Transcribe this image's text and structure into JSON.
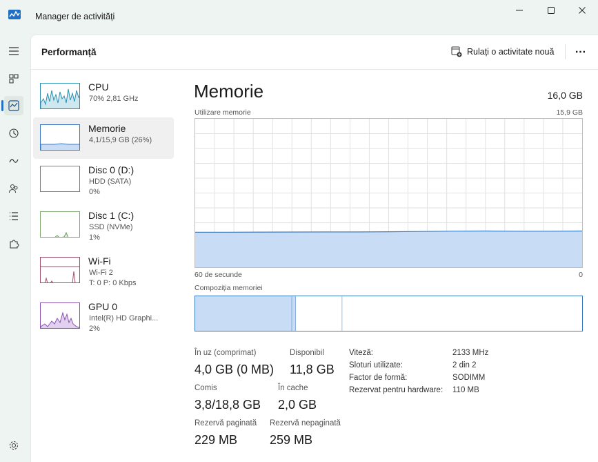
{
  "app": {
    "title": "Manager de activități"
  },
  "nav": {
    "items": [
      {
        "id": "menu"
      },
      {
        "id": "processes"
      },
      {
        "id": "performance",
        "active": true
      },
      {
        "id": "history"
      },
      {
        "id": "startup"
      },
      {
        "id": "users"
      },
      {
        "id": "details"
      },
      {
        "id": "services"
      },
      {
        "id": "settings"
      }
    ]
  },
  "header": {
    "title": "Performanță",
    "run_task_label": "Rulați o activitate nouă",
    "more_label": "⋯"
  },
  "resources": [
    {
      "name": "CPU",
      "sub1": "70%  2,81 GHz",
      "sub2": "",
      "selected": false
    },
    {
      "name": "Memorie",
      "sub1": "4,1/15,9 GB (26%)",
      "sub2": "",
      "selected": true
    },
    {
      "name": "Disc 0 (D:)",
      "sub1": "HDD (SATA)",
      "sub2": "0%",
      "selected": false
    },
    {
      "name": "Disc 1 (C:)",
      "sub1": "SSD (NVMe)",
      "sub2": "1%",
      "selected": false
    },
    {
      "name": "Wi-Fi",
      "sub1": "Wi-Fi 2",
      "sub2": "T: 0  P: 0 Kbps",
      "selected": false
    },
    {
      "name": "GPU 0",
      "sub1": "Intel(R) HD Graphi...",
      "sub2": "2%",
      "selected": false
    }
  ],
  "memory": {
    "title": "Memorie",
    "total": "16,0 GB",
    "usage_label": "Utilizare memorie",
    "usage_max": "15,9 GB",
    "time_left": "60 de secunde",
    "time_right": "0",
    "composition_label": "Compoziția memoriei",
    "stats": {
      "in_use_label": "În uz (comprimat)",
      "in_use_value": "4,0 GB (0 MB)",
      "available_label": "Disponibil",
      "available_value": "11,8 GB",
      "committed_label": "Comis",
      "committed_value": "3,8/18,8 GB",
      "cached_label": "În cache",
      "cached_value": "2,0 GB",
      "paged_label": "Rezervă paginată",
      "paged_value": "229 MB",
      "nonpaged_label": "Rezervă nepaginată",
      "nonpaged_value": "259 MB"
    },
    "specs": [
      {
        "label": "Viteză:",
        "value": "2133 MHz"
      },
      {
        "label": "Sloturi utilizate:",
        "value": "2 din 2"
      },
      {
        "label": "Factor de formă:",
        "value": "SODIMM"
      },
      {
        "label": "Rezervat pentru hardware:",
        "value": "110 MB"
      }
    ]
  },
  "chart_data": {
    "type": "area",
    "title": "Utilizare memorie",
    "ylim": [
      0,
      15.9
    ],
    "x": [
      60,
      55,
      50,
      45,
      40,
      35,
      30,
      25,
      20,
      15,
      10,
      5,
      0
    ],
    "values": [
      3.75,
      3.75,
      3.76,
      3.77,
      3.78,
      3.78,
      3.8,
      3.83,
      3.87,
      3.88,
      3.86,
      3.86,
      3.88
    ],
    "composition": {
      "in_use_fraction": 0.25,
      "modified_fraction": 0.01,
      "standby_fraction": 0.12,
      "free_fraction": 0.62
    },
    "colors": {
      "fill": "#c8dcf5",
      "line": "#3a7ac0",
      "grid": "#e2e2e2"
    }
  }
}
